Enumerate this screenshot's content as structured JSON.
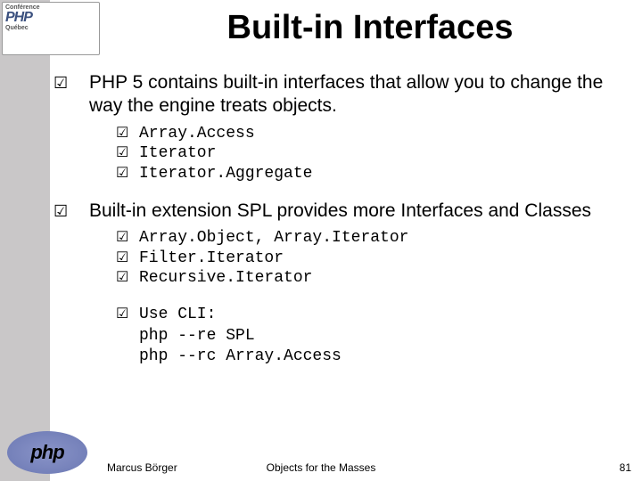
{
  "conference": {
    "label": "Conférence",
    "brand": "PHP",
    "location": "Québec"
  },
  "title": "Built-in Interfaces",
  "bullets": [
    {
      "icon": "☑",
      "text": "PHP 5 contains built-in interfaces that allow you to change the way the engine treats objects.",
      "sub": [
        {
          "icon": "☑",
          "code": "Array.Access"
        },
        {
          "icon": "☑",
          "code": "Iterator"
        },
        {
          "icon": "☑",
          "code": "Iterator.Aggregate"
        }
      ]
    },
    {
      "icon": "☑",
      "text": "Built-in extension SPL provides more Interfaces and Classes",
      "sub": [
        {
          "icon": "☑",
          "code": "Array.Object, Array.Iterator"
        },
        {
          "icon": "☑",
          "code": "Filter.Iterator"
        },
        {
          "icon": "☑",
          "code": "Recursive.Iterator"
        }
      ]
    }
  ],
  "cli": {
    "icon": "☑",
    "label": "Use CLI:",
    "lines": [
      "php --re SPL",
      "php --rc Array.Access"
    ]
  },
  "footer": {
    "author": "Marcus Börger",
    "title": "Objects for the Masses",
    "page": "81"
  },
  "php_logo": "php"
}
